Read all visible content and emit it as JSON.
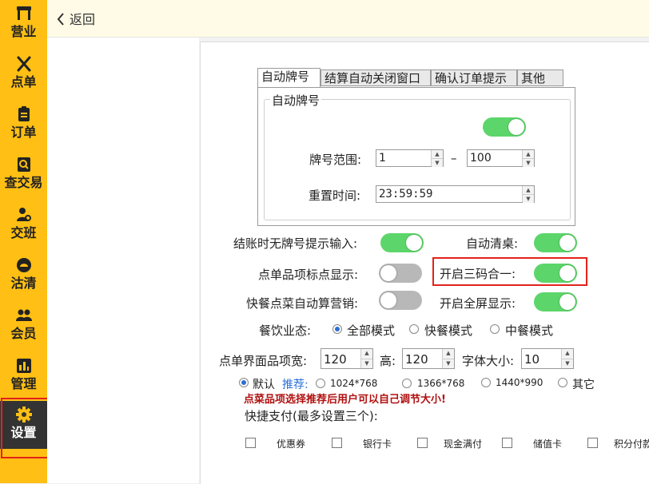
{
  "sidebar": {
    "items": [
      {
        "label": "营业",
        "icon": "shop-icon"
      },
      {
        "label": "点单",
        "icon": "utensils-icon"
      },
      {
        "label": "订单",
        "icon": "clipboard-icon"
      },
      {
        "label": "查交易",
        "icon": "search-doc-icon"
      },
      {
        "label": "交班",
        "icon": "user-search-icon"
      },
      {
        "label": "沽清",
        "icon": "cloche-icon"
      },
      {
        "label": "会员",
        "icon": "members-icon"
      },
      {
        "label": "管理",
        "icon": "bar-chart-icon"
      },
      {
        "label": "设置",
        "icon": "gear-icon"
      }
    ],
    "active": "设置",
    "accent": "#ffbf14"
  },
  "topbar": {
    "back_label": "返回"
  },
  "tabs": [
    {
      "label": "自动牌号",
      "active": true
    },
    {
      "label": "结算自动关闭窗口"
    },
    {
      "label": "确认订单提示"
    },
    {
      "label": "其他"
    }
  ],
  "auto_number": {
    "group_title": "自动牌号",
    "enabled": true,
    "range_label": "牌号范围:",
    "range_from": "1",
    "range_sep": "–",
    "range_to": "100",
    "reset_label": "重置时间:",
    "reset_time": "23:59:59"
  },
  "options": {
    "no_number_prompt": {
      "label": "结账时无牌号提示输入:",
      "on": true
    },
    "auto_clear_table": {
      "label": "自动清桌:",
      "on": true
    },
    "item_dot": {
      "label": "点单品项标点显示:",
      "on": false
    },
    "three_in_one": {
      "label": "开启三码合一:",
      "on": true
    },
    "fast_marketing": {
      "label": "快餐点菜自动算营销:",
      "on": false
    },
    "fullscreen": {
      "label": "开启全屏显示:",
      "on": true
    }
  },
  "business_mode": {
    "label": "餐饮业态:",
    "options": [
      "全部模式",
      "快餐模式",
      "中餐模式"
    ],
    "selected": "全部模式"
  },
  "item_size": {
    "width_label": "点单界面品项宽:",
    "width": "120",
    "height_label": "高:",
    "height": "120",
    "font_label": "字体大小:",
    "font": "10"
  },
  "resolution": {
    "default_label": "默认",
    "recommend_label": "推荐:",
    "options": [
      "1024*768",
      "1366*768",
      "1440*990",
      "其它"
    ],
    "selected": "默认",
    "hint": "点菜品项选择推荐后用户可以自己调节大小!"
  },
  "quick_pay": {
    "label": "快捷支付(最多设置三个):",
    "options": [
      "优惠券",
      "银行卡",
      "现金满付",
      "储值卡",
      "积分付款"
    ]
  },
  "colors": {
    "toggle_on": "#5cd66a",
    "toggle_off": "#b8b8b8",
    "highlight": "#e2231a"
  }
}
